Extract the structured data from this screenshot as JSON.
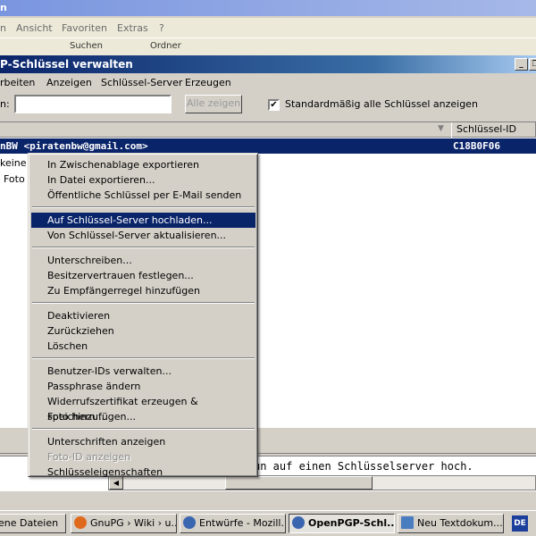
{
  "explorer": {
    "title_fragment": "n",
    "menu": [
      "n",
      "Ansicht",
      "Favoriten",
      "Extras",
      "?"
    ],
    "toolbar": {
      "search": "Suchen",
      "folders": "Ordner"
    }
  },
  "window": {
    "title": "P-Schlüssel verwalten",
    "min_glyph": "_",
    "restore_glyph": "❐",
    "menu": [
      "rbeiten",
      "Anzeigen",
      "Schlüssel-Server",
      "Erzeugen"
    ],
    "search_label": "n:",
    "search_value": "",
    "show_all_button": "Alle zeigen",
    "checkbox_checked": "✔",
    "checkbox_label": "Standardmäßig alle Schlüssel anzeigen"
  },
  "list": {
    "header_sort": "▼",
    "header_keyid": "Schlüssel-ID",
    "selected_row": {
      "uid": "nBW <piratenbw@gmail.com>",
      "keyid": "C18B0F06"
    },
    "sub_rows": [
      "keine (",
      "Foto "
    ]
  },
  "status_text": "un auf einen Schlüsselserver hoch.",
  "context_menu": {
    "groups": [
      [
        "In Zwischenablage exportieren",
        "In Datei exportieren...",
        "Öffentliche Schlüssel per E-Mail senden"
      ],
      [
        "Auf Schlüssel-Server hochladen...",
        "Von Schlüssel-Server aktualisieren..."
      ],
      [
        "Unterschreiben...",
        "Besitzervertrauen festlegen...",
        "Zu Empfängerregel hinzufügen"
      ],
      [
        "Deaktivieren",
        "Zurückziehen",
        "Löschen"
      ],
      [
        "Benutzer-IDs verwalten...",
        "Passphrase ändern",
        "Widerrufszertifikat erzeugen & speichern...",
        "Foto hinzufügen..."
      ],
      [
        "Unterschriften anzeigen",
        "Foto-ID anzeigen",
        "Schlüsseleigenschaften"
      ]
    ],
    "highlighted": "Auf Schlüssel-Server hochladen...",
    "disabled": [
      "Foto-ID anzeigen"
    ]
  },
  "taskbar": {
    "tasks": [
      {
        "label": "ene Dateien",
        "icon": "folder-icon",
        "color": "#e8c25a"
      },
      {
        "label": "GnuPG › Wiki › u...",
        "icon": "firefox-icon",
        "color": "#e06a1c"
      },
      {
        "label": "Entwürfe - Mozill...",
        "icon": "thunderbird-icon",
        "color": "#3a66b0"
      },
      {
        "label": "OpenPGP-Schl...",
        "icon": "thunderbird-icon",
        "color": "#3a66b0"
      },
      {
        "label": "Neu Textdokum...",
        "icon": "notepad-icon",
        "color": "#4a7cc0"
      }
    ],
    "language": "DE"
  }
}
